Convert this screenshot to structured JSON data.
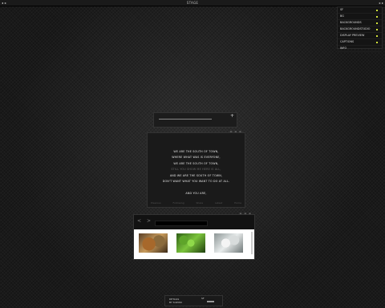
{
  "topbar": {
    "title": "STAGE",
    "left_icons": "◂ ◂",
    "right_icons": "▸ ▸"
  },
  "menu": {
    "items": [
      "SF",
      "BG",
      "BACKGROUNDS",
      "BACKGROUNDSTUDIO",
      "DISPLAY PREVIEW",
      "CAPTIONS",
      "INFO"
    ],
    "accent": "#cfe03a"
  },
  "slider": {
    "plus": "+"
  },
  "text_window": {
    "controls": "▬ ▬ ▬",
    "lines": [
      "WE ARE THE SOUTH OF TOWN,",
      "WHERE WHAT WAS IS EVERYONE,",
      "WE ARE THE SOUTH OF TOWN,",
      "STILL YOU SHOW ME HERE IS ALL,",
      "AND WE ARE THE SOUTH OF TOWN,",
      "DON'T WANT WHAT YOU WANT TO DO AT ALL.",
      "",
      "AND YOU ARE,"
    ],
    "tabs": [
      "Previous",
      "Following",
      "Share",
      "Latest",
      "Home"
    ]
  },
  "browser": {
    "back": "<",
    "forward": ">"
  },
  "panel": {
    "line1": "DETAILS",
    "line2": "BY SUZUKI",
    "label": "SF"
  }
}
